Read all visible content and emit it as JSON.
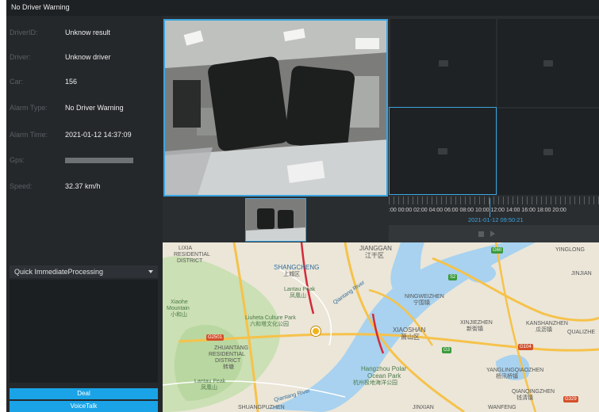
{
  "window": {
    "title": "No Driver Warning"
  },
  "info": {
    "rows": [
      {
        "label": "DriverID:",
        "value": "Unknow result"
      },
      {
        "label": "Driver:",
        "value": "Unknow driver"
      },
      {
        "label": "Car:",
        "value": "156"
      },
      {
        "label": "Alarm Type:",
        "value": "No Driver Warning"
      },
      {
        "label": "Alarm Time:",
        "value": "2021-01-12 14:37:09"
      },
      {
        "label": "Gps:",
        "value": ""
      },
      {
        "label": "Speed:",
        "value": "32.37 km/h"
      }
    ]
  },
  "processing": {
    "dropdown_value": "Quick ImmediateProcessing"
  },
  "buttons": {
    "deal": "Deal",
    "voicetalk": "VoiceTalk"
  },
  "timeline": {
    "scale": ":00 00:00 02:00 04:00 06:00 08:00 10:00 12:00 14:00 16:00 18:00 20:00",
    "current_time": "2021-01-12 09:50:21"
  },
  "map": {
    "labels": [
      "LIXIA",
      "RESIDENTIAL",
      "DISTRICT",
      "JIANGGAN",
      "江干区",
      "SHANGCHENG",
      "上城区",
      "Lantau Peak",
      "凤凰山",
      "Xiaohe",
      "Mountain",
      "小和山",
      "Liuheta Culture Park",
      "六和塔文化公园",
      "ZHUANTANG",
      "RESIDENTIAL",
      "DISTRICT",
      "转塘",
      "Lantau Peak",
      "凤凰山",
      "SHUANGPUZHEN",
      "NINGWEIZHEN",
      "宁围镇",
      "XIAOSHAN",
      "萧山区",
      "XINJIEZHEN",
      "新街镇",
      "KANSHANZHEN",
      "瓜沥镇",
      "YANGLINGQIAOZHEN",
      "杨汛桥镇",
      "QIANQINGZHEN",
      "钱清镇",
      "Hangzhou Polar",
      "Ocean Park",
      "杭州极地海洋公园",
      "Qiantang River",
      "Qiantang River",
      "G2501",
      "S2",
      "G60",
      "G3",
      "G104",
      "G329",
      "YINGLONG",
      "QUALIZHE",
      "JINJIAN",
      "JINXIAN",
      "WANFENG"
    ]
  },
  "colors": {
    "accent": "#1aa3e6",
    "panel": "#25282b"
  }
}
